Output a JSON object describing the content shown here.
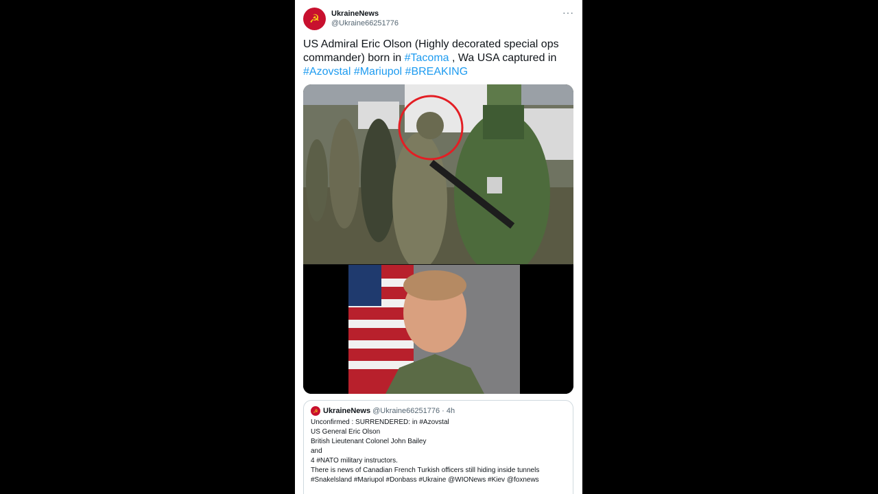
{
  "tweet": {
    "author_name": "UkraineNews",
    "author_handle": "@Ukraine66251776",
    "more_icon": "more-dots-icon",
    "text_1": "US Admiral Eric Olson (Highly decorated special ops commander) born in ",
    "tag_tacoma": "#Tacoma",
    "text_2": " , Wa USA captured in ",
    "tag_azovstal": "#Azovstal",
    "tag_mariupol": "#Mariupol",
    "tag_breaking": "#BREAKING",
    "accent_color": "#1d9bf0"
  },
  "quote": {
    "author_name": "UkraineNews",
    "author_handle": "@Ukraine66251776",
    "time": "· 4h",
    "lines": [
      "Unconfirmed : SURRENDERED: in #Azovstal",
      "US General Eric Olson",
      "British Lieutenant Colonel John Bailey",
      "and",
      "4 #NATO military instructors.",
      "There is news of Canadian French Turkish officers still hiding inside tunnels",
      "#Snakelsland #Mariupol #Donbass #Ukraine @WIONews #Kiev @foxnews"
    ]
  }
}
